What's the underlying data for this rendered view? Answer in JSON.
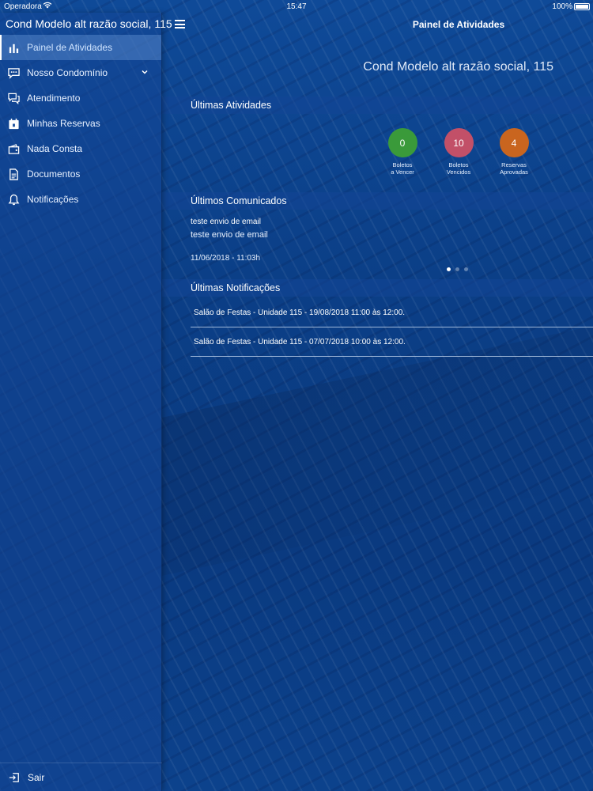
{
  "status_bar": {
    "carrier": "Operadora",
    "time": "15:47",
    "battery": "100%"
  },
  "sidebar": {
    "header": "Cond Modelo alt razão social, 115",
    "items": [
      {
        "label": "Painel de Atividades",
        "icon": "bar-chart-icon",
        "active": true
      },
      {
        "label": "Nosso Condomínio",
        "icon": "chat-icon",
        "expandable": true
      },
      {
        "label": "Atendimento",
        "icon": "messages-icon"
      },
      {
        "label": "Minhas Reservas",
        "icon": "calendar-icon"
      },
      {
        "label": "Nada Consta",
        "icon": "wallet-icon"
      },
      {
        "label": "Documentos",
        "icon": "document-icon"
      },
      {
        "label": "Notificações",
        "icon": "bell-icon"
      }
    ],
    "logout_label": "Sair"
  },
  "topbar": {
    "title": "Painel de Atividades"
  },
  "condo_name": "Cond Modelo alt razão social, 115",
  "sections": {
    "atividades": "Últimas Atividades",
    "comunicados": "Últimos Comunicados",
    "notificacoes": "Últimas Notificações"
  },
  "stats": [
    {
      "value": "0",
      "line1": "Boletos",
      "line2": "a Vencer",
      "color": "#3a9a3a"
    },
    {
      "value": "10",
      "line1": "Boletos",
      "line2": "Vencidos",
      "color": "#c25068"
    },
    {
      "value": "4",
      "line1": "Reservas",
      "line2": "Aprovadas",
      "color": "#c9651f"
    }
  ],
  "communication": {
    "title": "teste envio de email",
    "body": "teste envio de email",
    "date": "11/06/2018 - 11:03h",
    "pages": 3,
    "current_page": 1
  },
  "notifications": [
    "Salão de Festas - Unidade 115 - 19/08/2018 11:00 às 12:00.",
    "Salão de Festas - Unidade 115 - 07/07/2018 10:00 às 12:00."
  ],
  "colors": {
    "background": "#0b3d82",
    "panel": "#1446969c"
  }
}
